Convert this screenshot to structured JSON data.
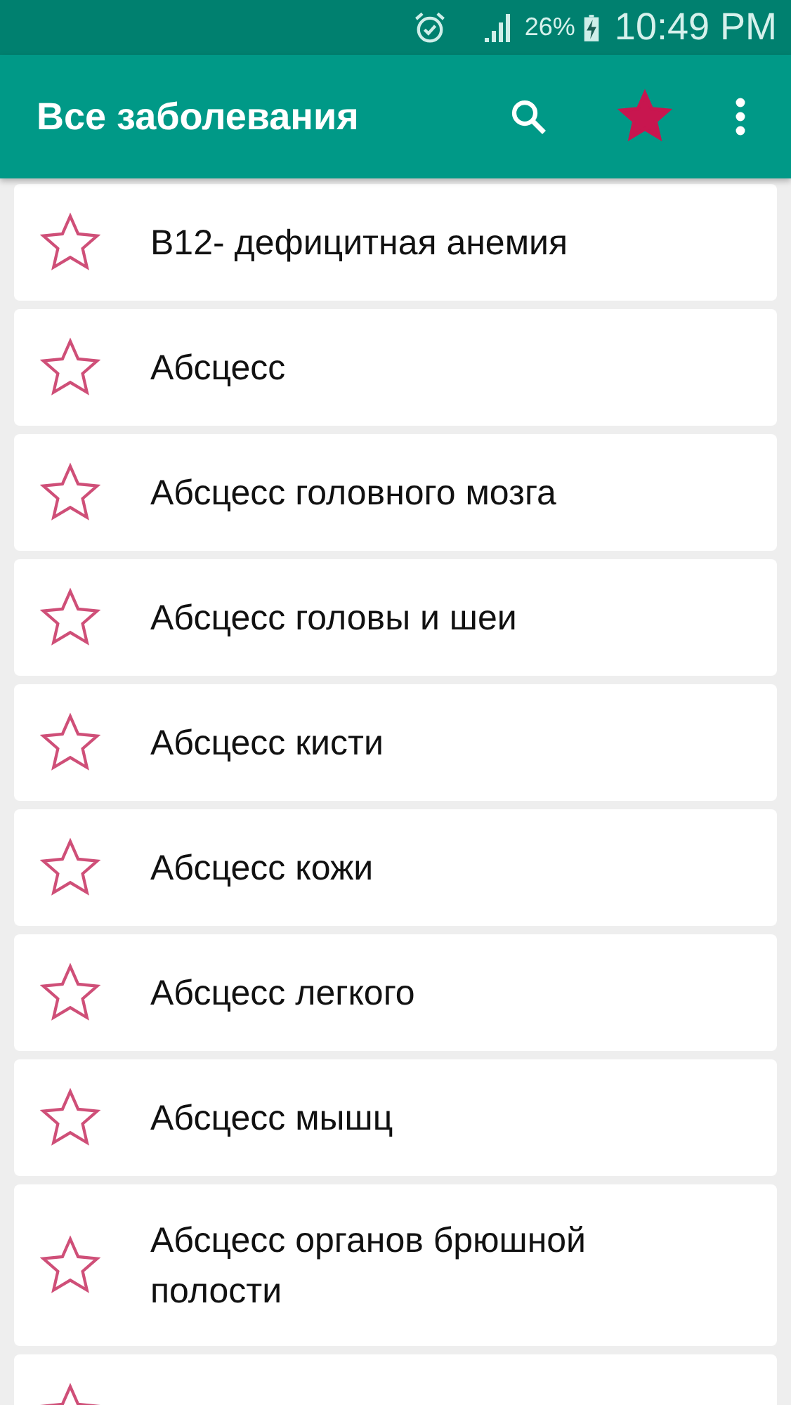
{
  "status_bar": {
    "battery": "26%",
    "time": "10:49 PM"
  },
  "app_bar": {
    "title": "Все заболевания",
    "favorites_filter": {
      "on": true
    }
  },
  "items": [
    {
      "label": "B12- дефицитная анемия",
      "favorite": false
    },
    {
      "label": "Абсцесс",
      "favorite": false
    },
    {
      "label": "Абсцесс головного мозга",
      "favorite": false
    },
    {
      "label": "Абсцесс головы и шеи",
      "favorite": false
    },
    {
      "label": "Абсцесс кисти",
      "favorite": false
    },
    {
      "label": "Абсцесс кожи",
      "favorite": false
    },
    {
      "label": "Абсцесс легкого",
      "favorite": false
    },
    {
      "label": "Абсцесс мышц",
      "favorite": false
    },
    {
      "label": "Абсцесс органов брюшной полости",
      "favorite": false
    },
    {
      "favorite": false
    }
  ]
}
